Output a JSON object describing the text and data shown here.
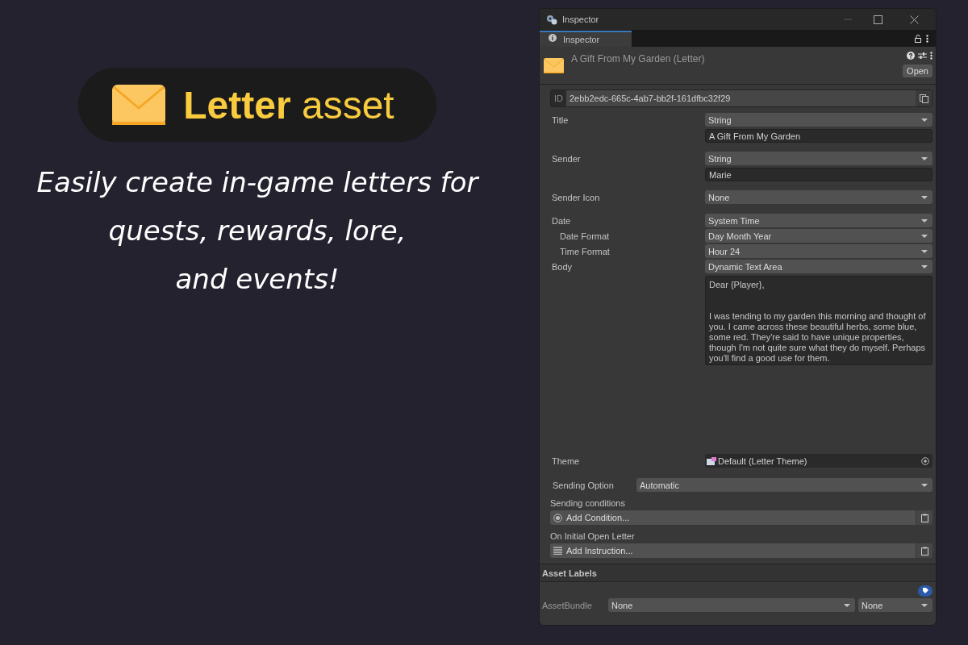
{
  "banner": {
    "title": "**Letter** asset",
    "tagline": "Easily create in-game letters for\nquests, rewards, lore,\nand events!"
  },
  "window": {
    "title": "Inspector"
  },
  "tabs": [
    {
      "label": "Inspector",
      "selected": true
    }
  ],
  "asset": {
    "name": "A Gift From My Garden (Letter)",
    "open_button": "Open",
    "id_label": "ID",
    "id": "2ebb2edc-665c-4ab7-bb2f-161dfbc32f29"
  },
  "fields": [
    {
      "kind": "typed",
      "label": "Title",
      "type": "String",
      "value": "A Gift From My Garden"
    },
    {
      "kind": "typed",
      "label": "Sender",
      "type": "String",
      "value": "Marie"
    },
    {
      "kind": "dropdown",
      "label": "Sender Icon",
      "value": "None"
    },
    {
      "kind": "group",
      "label": "Date",
      "value": "System Time",
      "children": [
        {
          "kind": "dropdown",
          "label": "Date Format",
          "value": "Day Month Year"
        },
        {
          "kind": "dropdown",
          "label": "Time Format",
          "value": "Hour 24"
        }
      ]
    },
    {
      "kind": "textarea",
      "label": "Body",
      "type": "Dynamic Text Area",
      "value": "Dear {Player},\n\n\nI was tending to my garden this morning and thought of you. I came across these beautiful herbs, some blue, some red. They're said to have unique properties, though I'm not quite sure what they do myself. Perhaps you'll find a good use for them."
    },
    {
      "kind": "object",
      "label": "Theme",
      "value": "Default (Letter Theme)"
    }
  ],
  "sending_option": {
    "label": "Sending Option",
    "value": "Automatic"
  },
  "lists": [
    {
      "kind": "condition",
      "label": "Sending conditions",
      "button": "Add Condition..."
    },
    {
      "kind": "instruction",
      "label": "On Initial Open Letter",
      "button": "Add Instruction..."
    }
  ],
  "asset_labels": {
    "title": "Asset Labels",
    "bundle_label": "AssetBundle",
    "bundle": "None",
    "variant": "None"
  }
}
